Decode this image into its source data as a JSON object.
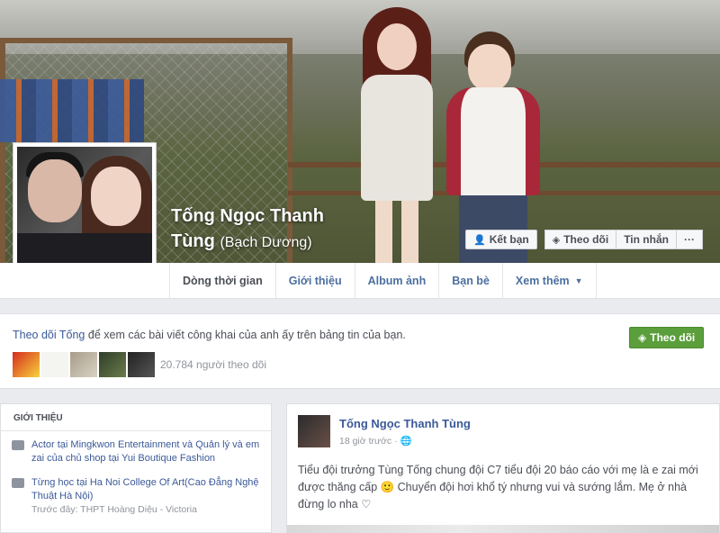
{
  "profile": {
    "name_line1": "Tống Ngọc Thanh",
    "name_line2": "Tùng",
    "alt_name": "(Bạch Dương)"
  },
  "actions": {
    "add_friend": "Kết bạn",
    "follow": "Theo dõi",
    "message": "Tin nhắn",
    "more": "···"
  },
  "tabs": [
    {
      "label": "Dòng thời gian"
    },
    {
      "label": "Giới thiệu"
    },
    {
      "label": "Album ảnh"
    },
    {
      "label": "Bạn bè"
    },
    {
      "label": "Xem thêm"
    }
  ],
  "follow_box": {
    "link_text": "Theo dõi Tống",
    "rest_text": " để xem các bài viết công khai của anh ấy trên bảng tin của bạn.",
    "follow_button": "Theo dõi",
    "followers": "20.784 người theo dõi"
  },
  "intro": {
    "title": "GIỚI THIỆU",
    "items": [
      {
        "text": "Actor tại Mingkwon Entertainment và Quản lý và em zai của chủ shop tại Yui Boutique Fashion",
        "sub": ""
      },
      {
        "text": "Từng học tại Ha Noi College Of Art(Cao Đẳng Nghệ Thuật Hà Nội)",
        "sub": "Trước đây: THPT Hoàng Diệu - Victoria"
      }
    ]
  },
  "post": {
    "author": "Tống Ngọc Thanh Tùng",
    "time": "18 giờ trước · 🌐",
    "text": "Tiểu đội trưởng Tùng Tống chung đội C7 tiểu đội 20 báo cáo với mẹ là e zai mới được thăng cấp 🙂 Chuyển đội hơi khổ tý nhưng vui và sướng lắm. Mẹ ở nhà đừng lo nha ♡"
  }
}
